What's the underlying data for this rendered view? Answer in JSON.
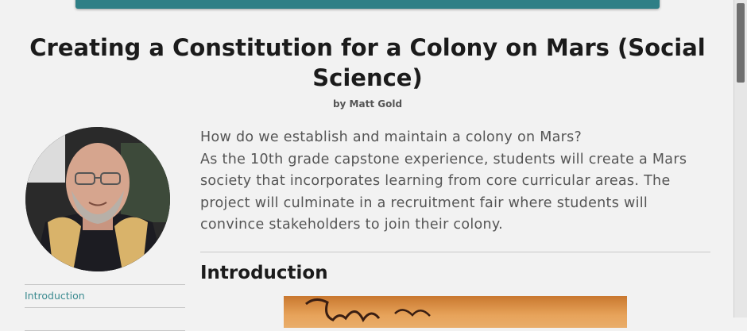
{
  "page": {
    "title": "Creating a Constitution for a Colony on Mars (Social Science)",
    "author": "by Matt Gold",
    "intro": {
      "question": "How do we establish and maintain a colony on Mars?",
      "description": "As the 10th grade capstone experience, students will create a Mars society that incorporates learning from core curricular areas. The project will culminate in a recruitment fair where students will convince stakeholders to join their colony."
    },
    "section_heading": "Introduction"
  },
  "nav": {
    "items": [
      {
        "label": "Introduction"
      },
      {
        "label": ""
      }
    ]
  },
  "colors": {
    "topbar": "#2f7f86",
    "link": "#3a8a8f",
    "background": "#f2f2f2"
  }
}
